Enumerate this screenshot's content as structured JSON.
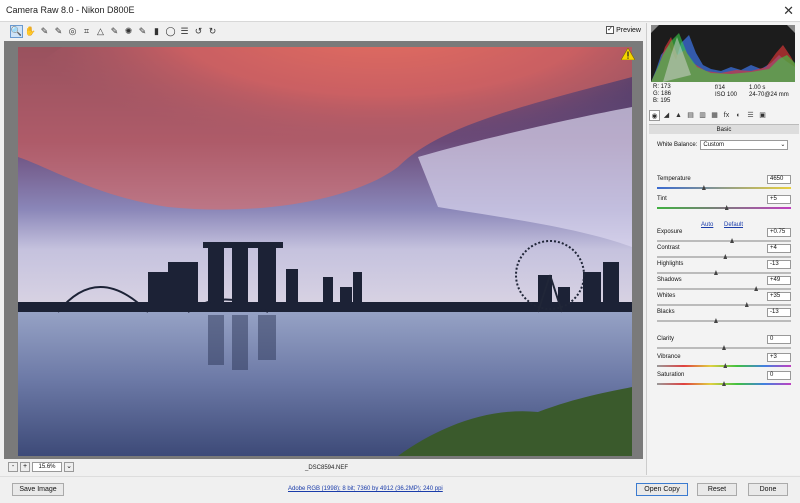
{
  "window": {
    "title": "Camera Raw 8.0  -  Nikon D800E",
    "close_glyph": "✕"
  },
  "toolbar": {
    "tools": [
      {
        "name": "zoom-tool-icon",
        "glyph": "🔍"
      },
      {
        "name": "hand-tool-icon",
        "glyph": "✋"
      },
      {
        "name": "white-balance-tool-icon",
        "glyph": "✎"
      },
      {
        "name": "color-sampler-tool-icon",
        "glyph": "✎"
      },
      {
        "name": "targeted-adjustment-tool-icon",
        "glyph": "◎"
      },
      {
        "name": "crop-tool-icon",
        "glyph": "⌗"
      },
      {
        "name": "straighten-tool-icon",
        "glyph": "△"
      },
      {
        "name": "spot-removal-tool-icon",
        "glyph": "✎"
      },
      {
        "name": "red-eye-tool-icon",
        "glyph": "✺"
      },
      {
        "name": "adjustment-brush-icon",
        "glyph": "✎"
      },
      {
        "name": "graduated-filter-icon",
        "glyph": "▮"
      },
      {
        "name": "radial-filter-icon",
        "glyph": "◯"
      },
      {
        "name": "preferences-icon",
        "glyph": "☰"
      },
      {
        "name": "rotate-left-icon",
        "glyph": "↺"
      },
      {
        "name": "rotate-right-icon",
        "glyph": "↻"
      }
    ],
    "preview_label": "Preview",
    "preview_checked": "✓"
  },
  "canvas": {
    "filename": "_DSC8594.NEF",
    "zoom_value": "15.6%",
    "zoom_minus": "-",
    "zoom_plus": "+"
  },
  "histogram": {
    "rgb_r": "R:   173",
    "rgb_g": "G:   186",
    "rgb_b": "B:   195",
    "aperture": "f/14",
    "shutter": "1.00 s",
    "iso": "ISO 100",
    "lens": "24-70@24 mm"
  },
  "panel": {
    "section_title": "Basic",
    "white_balance_label": "White Balance:",
    "white_balance_value": "Custom",
    "auto_label": "Auto",
    "default_label": "Default",
    "sliders": [
      {
        "label": "Temperature",
        "value": "4650",
        "pos": 0.35
      },
      {
        "label": "Tint",
        "value": "+5",
        "pos": 0.52
      },
      {
        "label": "Exposure",
        "value": "+0.75",
        "pos": 0.56
      },
      {
        "label": "Contrast",
        "value": "+4",
        "pos": 0.51
      },
      {
        "label": "Highlights",
        "value": "-13",
        "pos": 0.44
      },
      {
        "label": "Shadows",
        "value": "+49",
        "pos": 0.74
      },
      {
        "label": "Whites",
        "value": "+35",
        "pos": 0.67
      },
      {
        "label": "Blacks",
        "value": "-13",
        "pos": 0.44
      },
      {
        "label": "Clarity",
        "value": "0",
        "pos": 0.5
      },
      {
        "label": "Vibrance",
        "value": "+3",
        "pos": 0.51
      },
      {
        "label": "Saturation",
        "value": "0",
        "pos": 0.5
      }
    ]
  },
  "footer": {
    "save_image": "Save Image",
    "workflow_link": "Adobe RGB (1998); 8 bit; 7360 by 4912 (36.2MP); 240 ppi",
    "open_copy": "Open Copy",
    "reset": "Reset",
    "done": "Done"
  }
}
